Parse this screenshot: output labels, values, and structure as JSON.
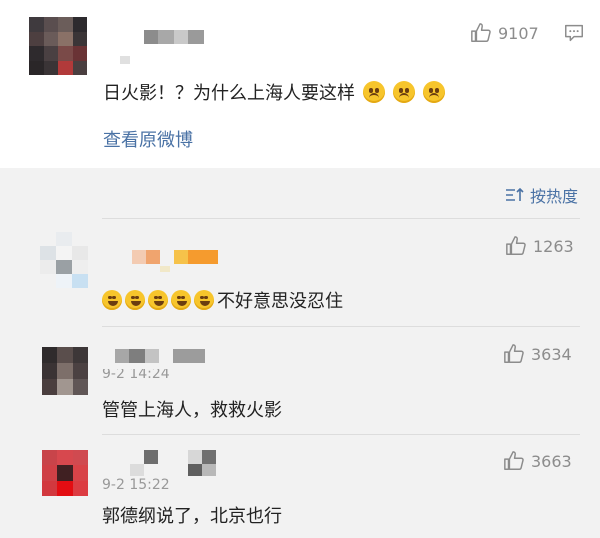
{
  "post": {
    "text": "日火影！？为什么上海人要这样",
    "likes": "9107",
    "view_original": "查看原微博",
    "emoji": [
      "frowning-face",
      "frowning-face",
      "frowning-face"
    ]
  },
  "thread": {
    "sort_label": "按热度",
    "comments": [
      {
        "text": "不好意思没忍住",
        "likes": "1263",
        "emoji_count": 5
      },
      {
        "text": "管管上海人，救救火影",
        "likes": "3634",
        "time": "9-2 14:24"
      },
      {
        "text": "郭德纲说了，北京也行",
        "likes": "3663",
        "time": "9-2 15:22"
      }
    ]
  },
  "colors": {
    "link": "#4a72a5",
    "background": "#f2f2f2",
    "card": "#ffffff"
  }
}
